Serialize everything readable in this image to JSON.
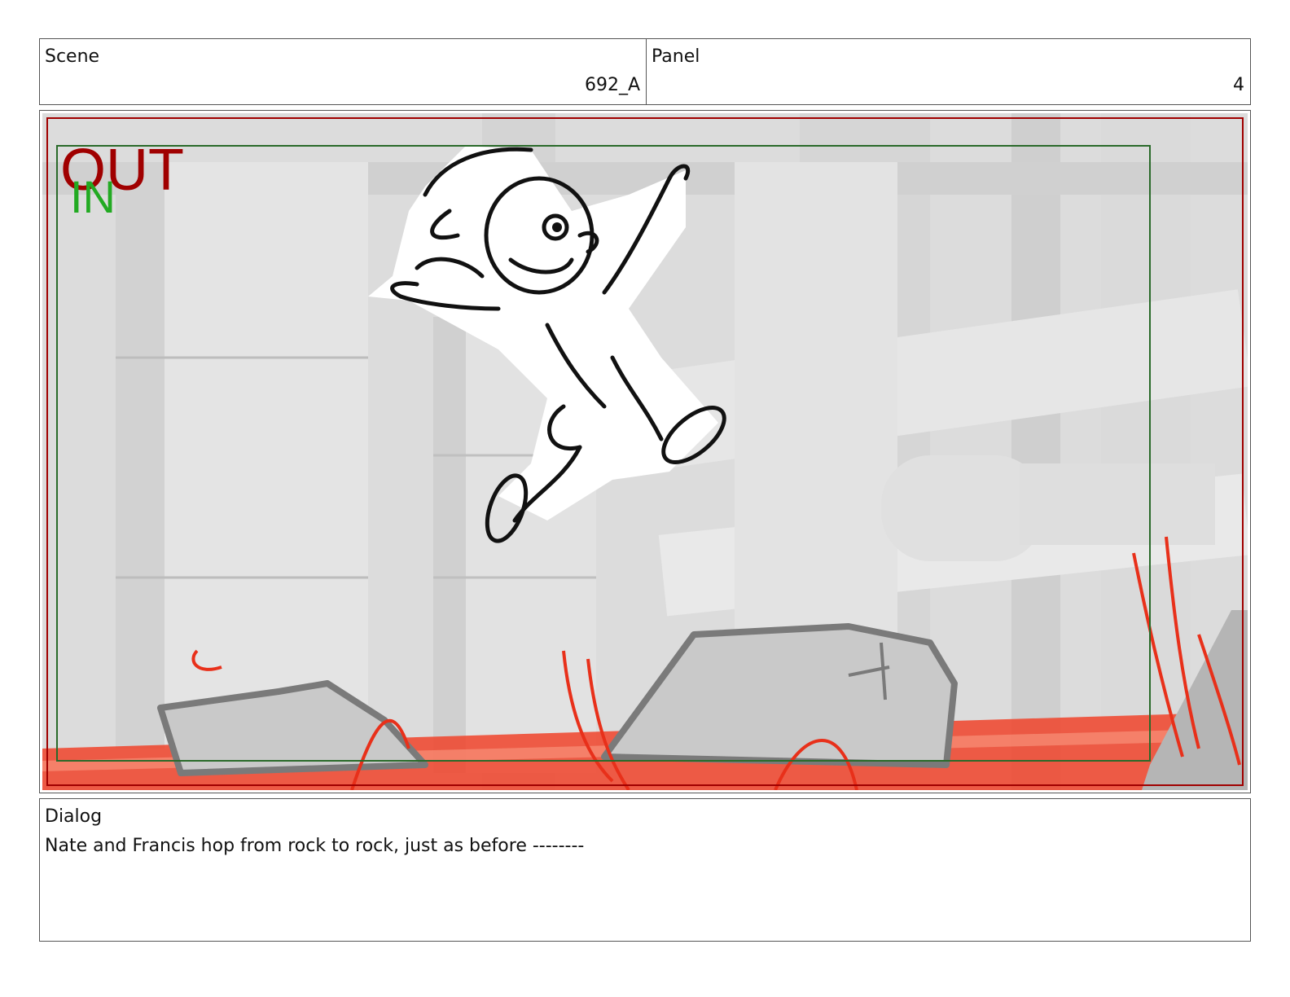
{
  "header": {
    "scene_label": "Scene",
    "scene_value": "692_A",
    "panel_label": "Panel",
    "panel_value": "4"
  },
  "frame": {
    "out_marker": "OUT",
    "in_marker": "IN",
    "colors": {
      "out": "#a00000",
      "in": "#22aa22",
      "safe_area": "#2a6a2a",
      "water": "#f0432a",
      "rocks": "#c9c9c9",
      "rock_outline": "#7a7a7a",
      "pipes": "#e2e2e2"
    }
  },
  "dialog": {
    "label": "Dialog",
    "text": "Nate and Francis hop from rock to rock, just as before --------"
  }
}
